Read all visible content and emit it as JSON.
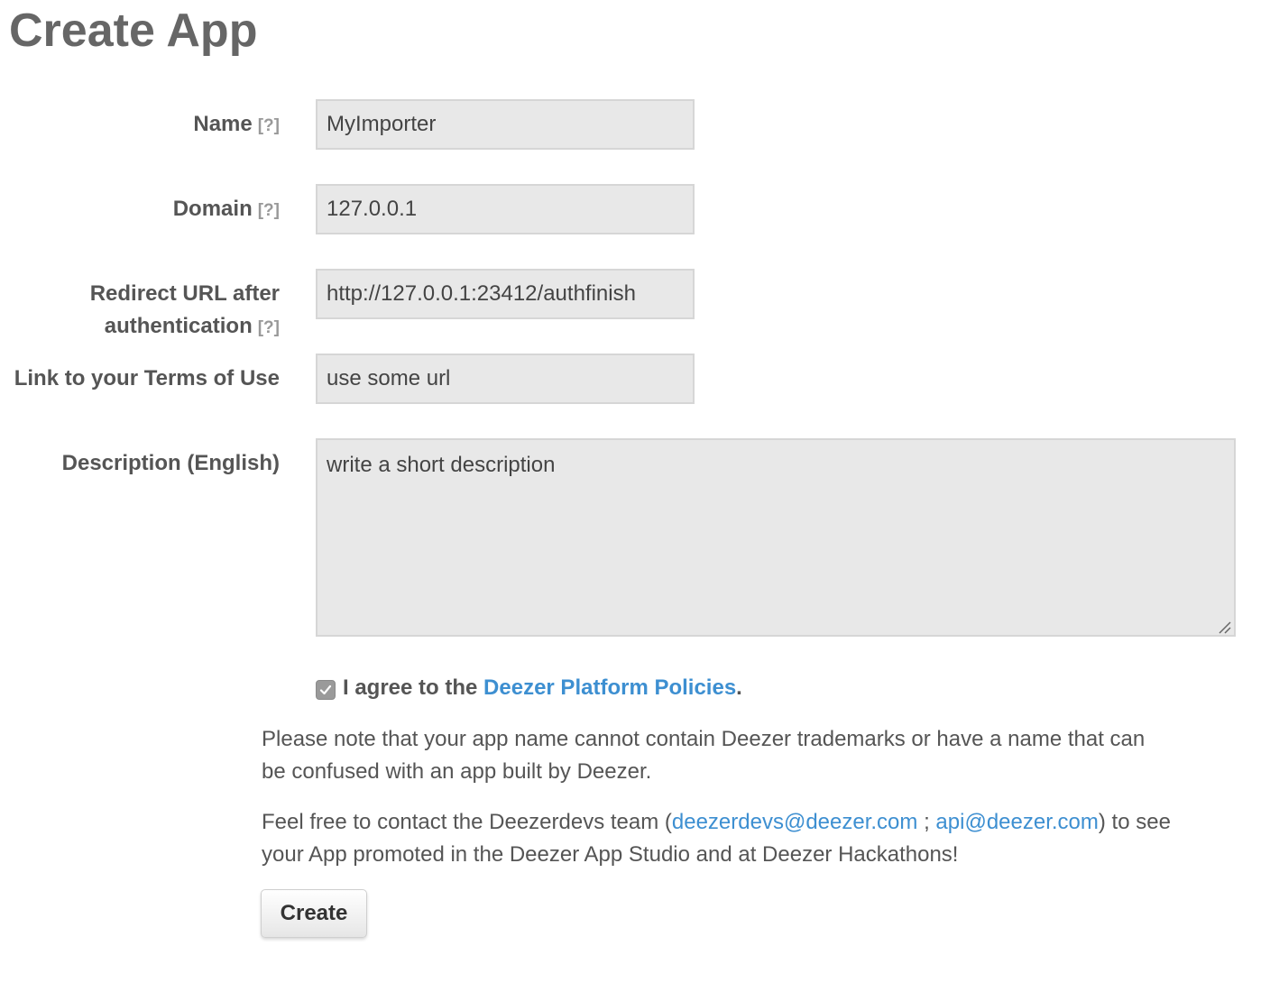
{
  "page": {
    "title": "Create App"
  },
  "form": {
    "help_marker": "[?]",
    "name": {
      "label": "Name",
      "value": "MyImporter"
    },
    "domain": {
      "label": "Domain",
      "value": "127.0.0.1"
    },
    "redirect": {
      "label_line1": "Redirect URL after",
      "label_line2": "authentication",
      "value": "http://127.0.0.1:23412/authfinish"
    },
    "terms": {
      "label": "Link to your Terms of Use",
      "value": "use some url"
    },
    "description": {
      "label": "Description (English)",
      "value": "write a short description"
    },
    "agree": {
      "checked": true,
      "prefix": "I agree to the ",
      "link_text": "Deezer Platform Policies",
      "suffix": "."
    }
  },
  "notes": {
    "trademark": "Please note that your app name cannot contain Deezer trademarks or have a name that can be confused with an app built by Deezer.",
    "contact_prefix": "Feel free to contact the Deezerdevs team (",
    "contact_email1": "deezerdevs@deezer.com",
    "contact_sep": " ; ",
    "contact_email2": "api@deezer.com",
    "contact_suffix": ") to see your App promoted in the Deezer App Studio and at Deezer Hackathons!"
  },
  "actions": {
    "create_label": "Create"
  },
  "colors": {
    "link": "#3d8fd1",
    "field_bg": "#e8e8e8",
    "text": "#555555"
  }
}
